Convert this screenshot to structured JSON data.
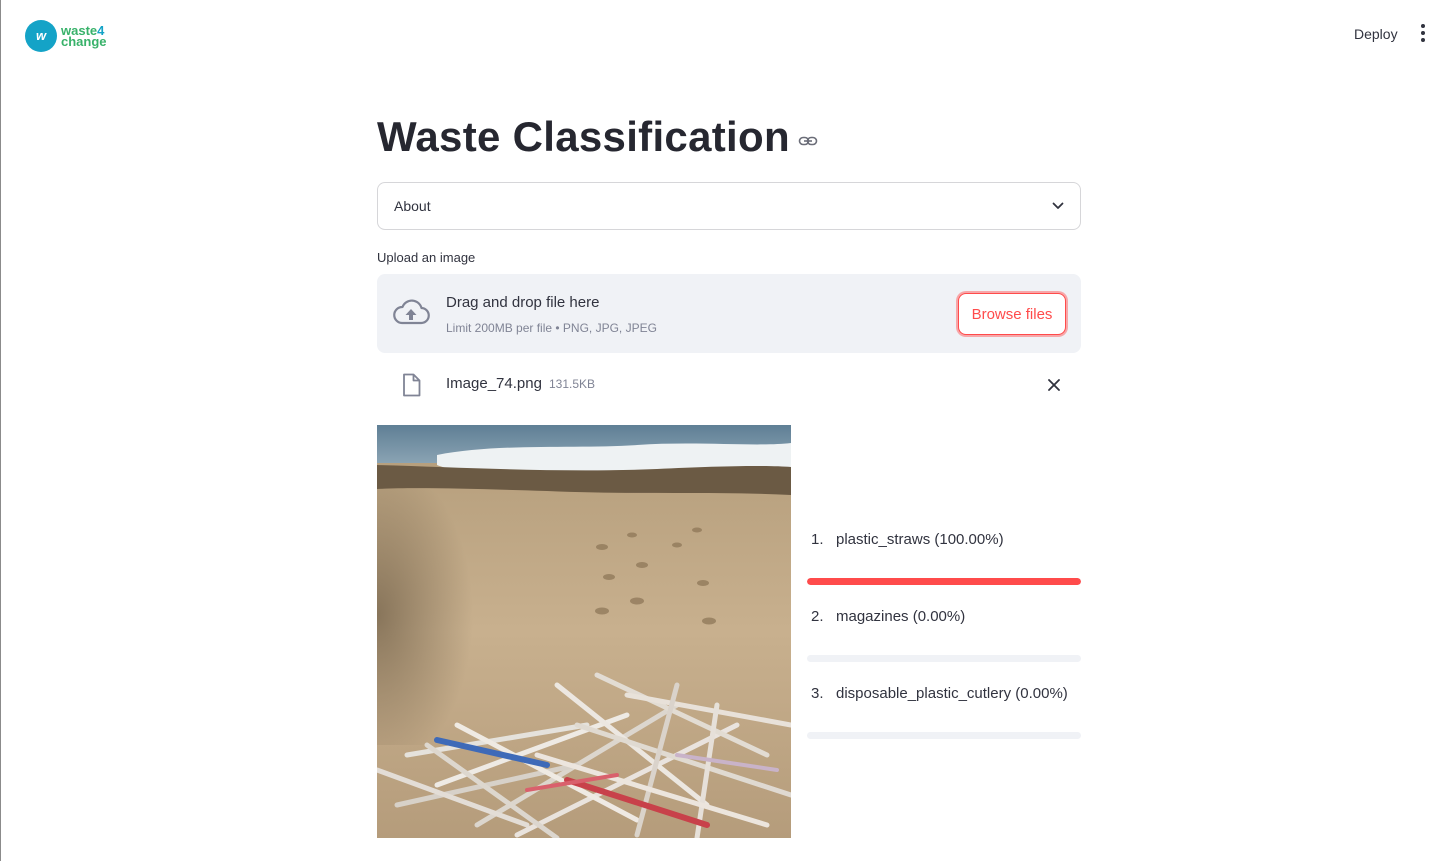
{
  "header": {
    "logo_line1": "waste",
    "logo_line1_accent": "4",
    "logo_line2": "change",
    "deploy_label": "Deploy"
  },
  "main": {
    "title": "Waste Classification",
    "expander_label": "About",
    "uploader": {
      "label": "Upload an image",
      "drop_title": "Drag and drop file here",
      "drop_limit": "Limit 200MB per file • PNG, JPG, JPEG",
      "browse_label": "Browse files"
    },
    "file": {
      "name": "Image_74.png",
      "size": "131.5KB"
    },
    "predictions": [
      {
        "rank": "1.",
        "text": "plastic_straws (100.00%)",
        "value": 1.0
      },
      {
        "rank": "2.",
        "text": "magazines (0.00%)",
        "value": 0.0
      },
      {
        "rank": "3.",
        "text": "disposable_plastic_cutlery (0.00%)",
        "value": 0.0
      }
    ]
  },
  "colors": {
    "accent": "#ff4b4b",
    "text": "#31333f",
    "muted": "#808495",
    "dropzone_bg": "#f0f2f6",
    "logo_blue": "#14a3c7",
    "logo_green": "#38b26a"
  }
}
